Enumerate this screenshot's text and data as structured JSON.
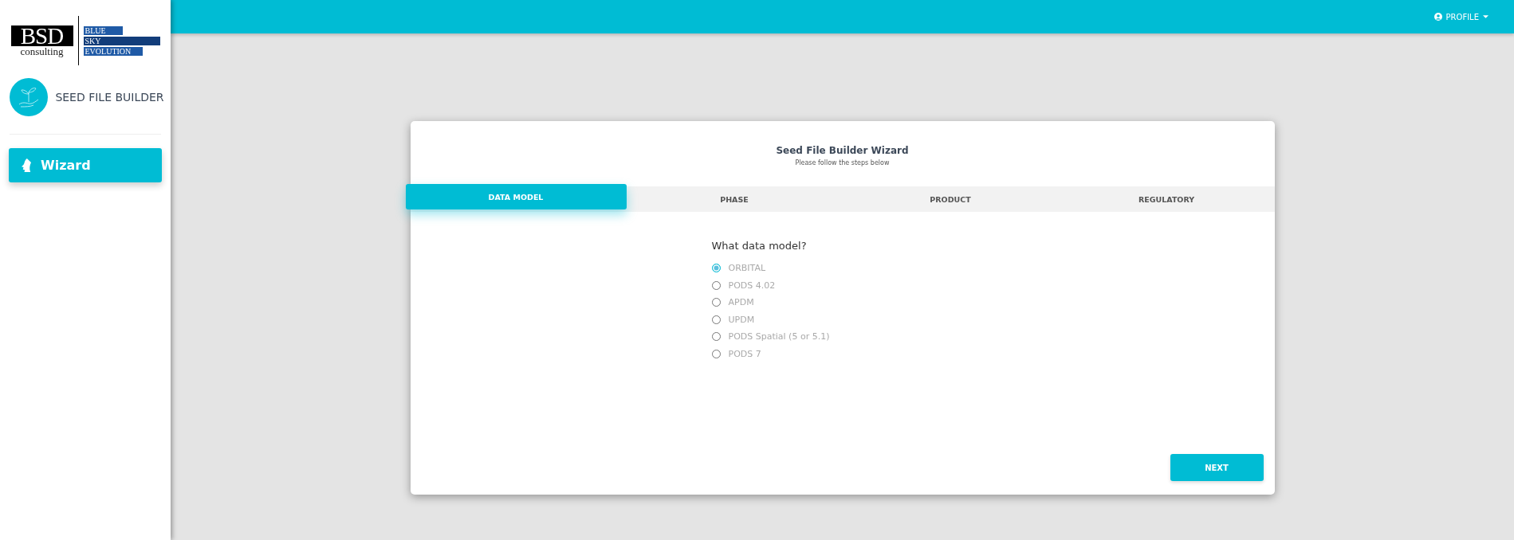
{
  "logo": {
    "left_top": "BSD",
    "left_bottom": "consulting",
    "right": [
      "BLUE",
      "SKY",
      "EVOLUTION"
    ]
  },
  "app": {
    "title": "SEED FILE BUILDER"
  },
  "sidebar": {
    "items": [
      {
        "label": "Wizard",
        "selected": true
      }
    ]
  },
  "top_bar": {
    "profile": "PROFILE"
  },
  "wizard": {
    "title": "Seed File Builder Wizard",
    "subtitle": "Please follow the steps below",
    "steps": [
      {
        "label": "DATA MODEL",
        "selected": true
      },
      {
        "label": "PHASE",
        "selected": false
      },
      {
        "label": "PRODUCT",
        "selected": false
      },
      {
        "label": "REGULATORY",
        "selected": false
      }
    ],
    "question": "What data model?",
    "options": [
      {
        "label": "ORBITAL",
        "selected": true
      },
      {
        "label": "PODS 4.02",
        "selected": false
      },
      {
        "label": "APDM",
        "selected": false
      },
      {
        "label": "UPDM",
        "selected": false
      },
      {
        "label": "PODS Spatial (5 or 5.1)",
        "selected": false
      },
      {
        "label": "PODS 7",
        "selected": false
      }
    ],
    "next_button": "NEXT"
  }
}
